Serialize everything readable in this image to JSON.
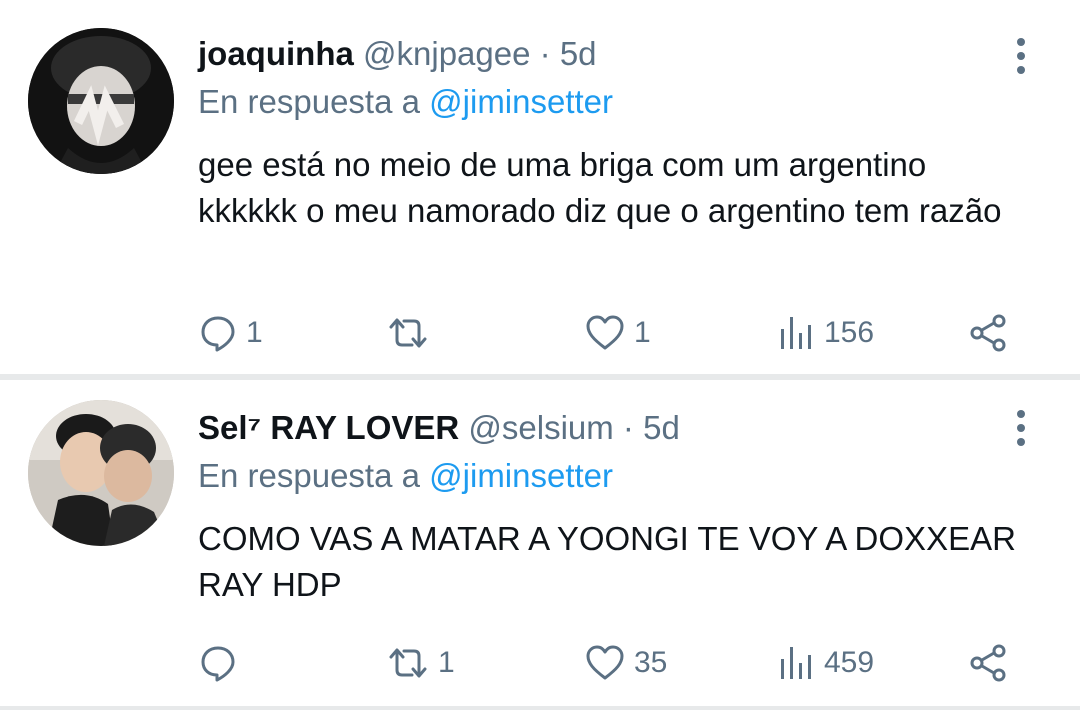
{
  "tweets": [
    {
      "name": "joaquinha",
      "handle": "@knjpagee",
      "separator": "·",
      "time": "5d",
      "reply_prefix": "En respuesta a",
      "reply_to": "@jiminsetter",
      "text": "gee está no meio de uma briga com um argentino kkkkkk o meu namorado diz que o argentino tem razão",
      "replies": "1",
      "retweets": "",
      "likes": "1",
      "views": "156",
      "avatar_icon": "avatar-photo"
    },
    {
      "name": "Sel⁷  RAY LOVER",
      "handle": "@selsium",
      "separator": "·",
      "time": "5d",
      "reply_prefix": "En respuesta a",
      "reply_to": "@jiminsetter",
      "text": "COMO VAS A MATAR A YOONGI TE VOY A DOXXEAR RAY HDP",
      "replies": "",
      "retweets": "1",
      "likes": "35",
      "views": "459",
      "avatar_icon": "avatar-photo"
    }
  ],
  "colors": {
    "text": "#0f1419",
    "secondary": "#5b7083",
    "link": "#1d9bf0",
    "divider": "#e7e9ea"
  },
  "icons": [
    "reply-icon",
    "retweet-icon",
    "like-icon",
    "views-icon",
    "share-icon",
    "more-options-icon"
  ]
}
